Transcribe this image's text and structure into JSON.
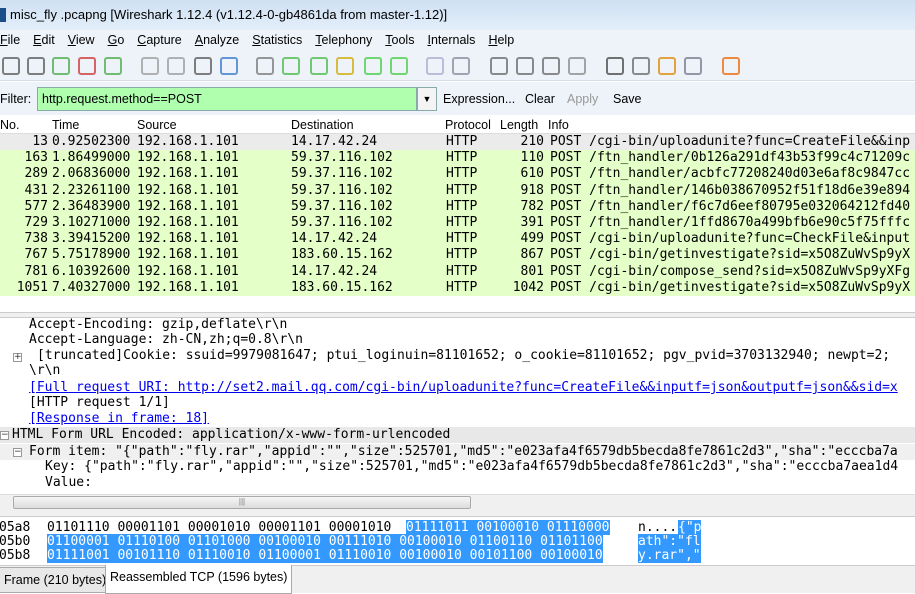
{
  "window": {
    "title": "misc_fly .pcapng   [Wireshark 1.12.4  (v1.12.4-0-gb4861da from master-1.12)]"
  },
  "menu": [
    "File",
    "Edit",
    "View",
    "Go",
    "Capture",
    "Analyze",
    "Statistics",
    "Telephony",
    "Tools",
    "Internals",
    "Help"
  ],
  "toolbar": [
    "interfaces-icon",
    "options-icon",
    "start-capture-icon",
    "stop-capture-icon",
    "restart-capture-icon",
    "open-icon",
    "save-icon",
    "close-icon",
    "reload-icon",
    "find-icon",
    "back-icon",
    "forward-icon",
    "go-to-packet-icon",
    "first-packet-icon",
    "last-packet-icon",
    "colorize-icon",
    "autoscroll-icon",
    "zoom-in-icon",
    "zoom-out-icon",
    "normal-size-icon",
    "resize-columns-icon",
    "capture-filters-icon",
    "display-filters-icon",
    "coloring-rules-icon",
    "preferences-icon",
    "help-icon"
  ],
  "filter": {
    "label": "Filter:",
    "value": "http.request.method==POST",
    "expression": "Expression...",
    "clear": "Clear",
    "apply": "Apply",
    "save": "Save"
  },
  "columns": [
    "No.",
    "Time",
    "Source",
    "Destination",
    "Protocol",
    "Length",
    "Info"
  ],
  "packets": [
    {
      "no": "13",
      "time": "0.92502300",
      "src": "192.168.1.101",
      "dst": "14.17.42.24",
      "proto": "HTTP",
      "len": "210",
      "info": "POST /cgi-bin/uploadunite?func=CreateFile&&inp"
    },
    {
      "no": "163",
      "time": "1.86499000",
      "src": "192.168.1.101",
      "dst": "59.37.116.102",
      "proto": "HTTP",
      "len": "110",
      "info": "POST /ftn_handler/0b126a291df43b53f99c4c71209c"
    },
    {
      "no": "289",
      "time": "2.06836000",
      "src": "192.168.1.101",
      "dst": "59.37.116.102",
      "proto": "HTTP",
      "len": "610",
      "info": "POST /ftn_handler/acbfc77208240d03e6af8c9847cc"
    },
    {
      "no": "431",
      "time": "2.23261100",
      "src": "192.168.1.101",
      "dst": "59.37.116.102",
      "proto": "HTTP",
      "len": "918",
      "info": "POST /ftn_handler/146b038670952f51f18d6e39e894"
    },
    {
      "no": "577",
      "time": "2.36483900",
      "src": "192.168.1.101",
      "dst": "59.37.116.102",
      "proto": "HTTP",
      "len": "782",
      "info": "POST /ftn_handler/f6c7d6eef80795e032064212fd40"
    },
    {
      "no": "729",
      "time": "3.10271000",
      "src": "192.168.1.101",
      "dst": "59.37.116.102",
      "proto": "HTTP",
      "len": "391",
      "info": "POST /ftn_handler/1ffd8670a499bfb6e90c5f75fffc"
    },
    {
      "no": "738",
      "time": "3.39415200",
      "src": "192.168.1.101",
      "dst": "14.17.42.24",
      "proto": "HTTP",
      "len": "499",
      "info": "POST /cgi-bin/uploadunite?func=CheckFile&input"
    },
    {
      "no": "767",
      "time": "5.75178900",
      "src": "192.168.1.101",
      "dst": "183.60.15.162",
      "proto": "HTTP",
      "len": "867",
      "info": "POST /cgi-bin/getinvestigate?sid=x5O8ZuWvSp9yX"
    },
    {
      "no": "781",
      "time": "6.10392600",
      "src": "192.168.1.101",
      "dst": "14.17.42.24",
      "proto": "HTTP",
      "len": "801",
      "info": "POST /cgi-bin/compose_send?sid=x5O8ZuWvSp9yXFg"
    },
    {
      "no": "1051",
      "time": "7.40327000",
      "src": "192.168.1.101",
      "dst": "183.60.15.162",
      "proto": "HTTP",
      "len": "1042",
      "info": "POST /cgi-bin/getinvestigate?sid=x5O8ZuWvSp9yX"
    }
  ],
  "details": {
    "accept_encoding": "Accept-Encoding: gzip,deflate\\r\\n",
    "accept_language": "Accept-Language: zh-CN,zh;q=0.8\\r\\n",
    "cookie": "[truncated]Cookie: ssuid=9979081647; ptui_loginuin=81101652; o_cookie=81101652; pgv_pvid=3703132940; newpt=2;",
    "crlf": "\\r\\n",
    "full_uri": "[Full request URI: http://set2.mail.qq.com/cgi-bin/uploadunite?func=CreateFile&&inputf=json&outputf=json&&sid=x",
    "http_request": "[HTTP request 1/1]",
    "response": "[Response in frame: 18]",
    "form_encoded": "HTML Form URL Encoded: application/x-www-form-urlencoded",
    "form_item": "Form item: \"{\"path\":\"fly.rar\",\"appid\":\"\",\"size\":525701,\"md5\":\"e023afa4f6579db5becda8fe7861c2d3\",\"sha\":\"ecccba7a",
    "key": "Key: {\"path\":\"fly.rar\",\"appid\":\"\",\"size\":525701,\"md5\":\"e023afa4f6579db5becda8fe7861c2d3\",\"sha\":\"ecccba7aea1d4",
    "value": "Value:"
  },
  "hex": [
    {
      "off": "05a8",
      "plain": "01101110 00001101 00001010 00001101 00001010 ",
      "hl": "01111011 00100010 01110000",
      "ascii_plain": "n....",
      "ascii_hl": "{\"p"
    },
    {
      "off": "05b0",
      "plain": "",
      "hl": "01100001 01110100 01101000 00100010 00111010 00100010 01100110 01101100",
      "ascii_plain": "",
      "ascii_hl": "ath\":\"fl"
    },
    {
      "off": "05b8",
      "plain": "",
      "hl": "01111001 00101110 01110010 01100001 01110010 00100010 00101100 00100010",
      "ascii_plain": "",
      "ascii_hl": "y.rar\",\""
    }
  ],
  "tabs": [
    "Frame (210 bytes)",
    "Reassembled TCP (1596 bytes)"
  ]
}
